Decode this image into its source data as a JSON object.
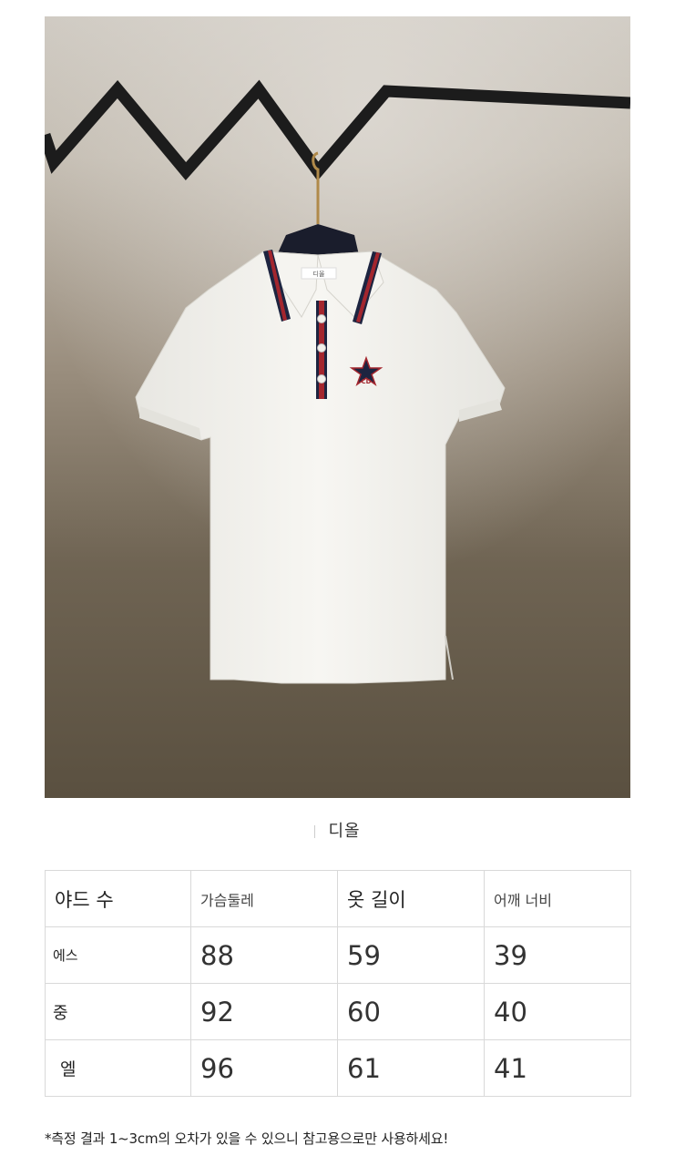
{
  "image": {
    "colors": {
      "wall_top": "#cfcac2",
      "wall_bottom": "#5a5040",
      "rail": "#1c1c1c",
      "shirt": "#f4f3ef",
      "collar_navy": "#1d2440",
      "collar_red": "#a3262e"
    },
    "label_text": "디올",
    "emblem_text": "CD"
  },
  "brand": {
    "name": "디올"
  },
  "size_table": {
    "headers": [
      "야드 수",
      "가슴둘레",
      "옷 길이",
      "어깨 너비"
    ],
    "rows": [
      {
        "label": "에스",
        "values": [
          "88",
          "59",
          "39"
        ]
      },
      {
        "label": "중",
        "values": [
          "92",
          "60",
          "40"
        ]
      },
      {
        "label": "엘",
        "values": [
          "96",
          "61",
          "41"
        ]
      }
    ]
  },
  "note": "*측정 결과 1~3cm의 오차가 있을 수 있으니 참고용으로만 사용하세요!"
}
